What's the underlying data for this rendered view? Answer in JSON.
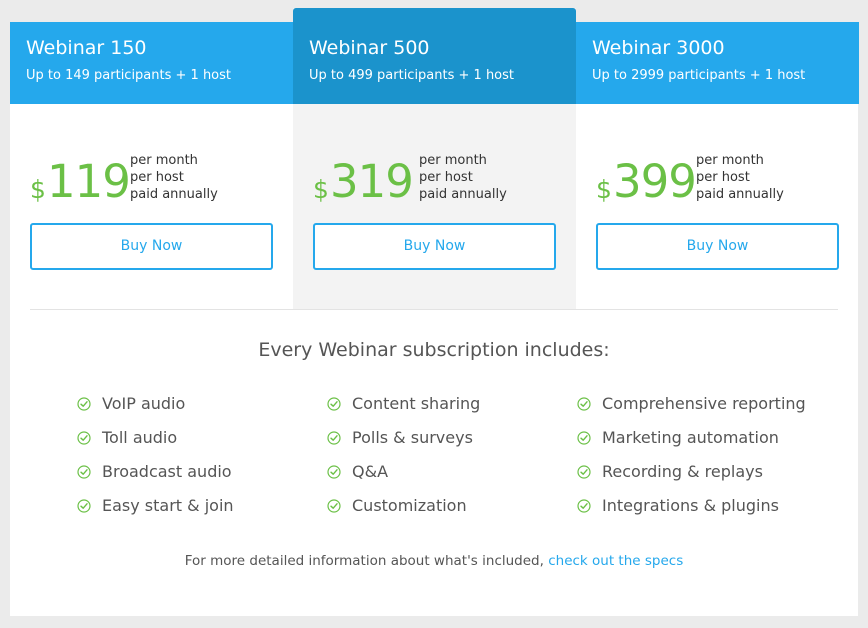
{
  "plans": [
    {
      "name": "Webinar 150",
      "participants": "Up to 149 participants + 1 host",
      "currency": "$",
      "price": "119",
      "terms": [
        "per month",
        "per host",
        "paid annually"
      ],
      "button": "Buy Now"
    },
    {
      "name": "Webinar 500",
      "participants": "Up to 499 participants + 1 host",
      "currency": "$",
      "price": "319",
      "terms": [
        "per month",
        "per host",
        "paid annually"
      ],
      "button": "Buy Now"
    },
    {
      "name": "Webinar 3000",
      "participants": "Up to 2999 participants + 1 host",
      "currency": "$",
      "price": "399",
      "terms": [
        "per month",
        "per host",
        "paid annually"
      ],
      "button": "Buy Now"
    }
  ],
  "includes": {
    "title": "Every Webinar subscription includes:",
    "columns": [
      [
        "VoIP audio",
        "Toll audio",
        "Broadcast audio",
        "Easy start & join"
      ],
      [
        "Content sharing",
        "Polls & surveys",
        "Q&A",
        "Customization"
      ],
      [
        "Comprehensive reporting",
        "Marketing automation",
        "Recording & replays",
        "Integrations & plugins"
      ]
    ]
  },
  "footer": {
    "text": "For more detailed information about what's included,",
    "link": "check out the specs"
  },
  "colors": {
    "header_blue": "#25a8ec",
    "featured_header_blue": "#1b93cc",
    "price_green": "#6bc046",
    "check_green": "#6bc046",
    "featured_background": "#f3f3f3"
  }
}
